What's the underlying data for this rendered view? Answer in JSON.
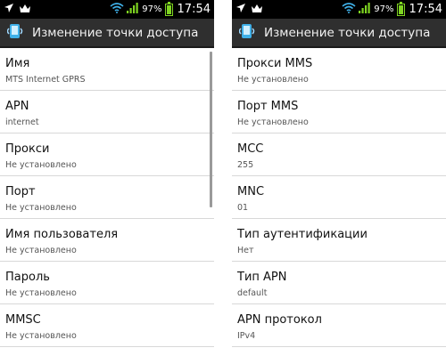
{
  "status_bar": {
    "battery_percent": "97%",
    "time": "17:54",
    "icons": [
      "navigation-arrow-icon",
      "crown-icon",
      "wifi-icon",
      "signal-icon",
      "battery-icon"
    ],
    "colors": {
      "wifi": "#3fb0e8",
      "signal": "#7ed321",
      "battery": "#7ed321"
    }
  },
  "action_bar": {
    "title": "Изменение точки доступа",
    "icon": "apn-settings-icon"
  },
  "left_screen": {
    "items": [
      {
        "title": "Имя",
        "value": "MTS Internet GPRS"
      },
      {
        "title": "APN",
        "value": "internet"
      },
      {
        "title": "Прокси",
        "value": "Не установлено"
      },
      {
        "title": "Порт",
        "value": "Не установлено"
      },
      {
        "title": "Имя пользователя",
        "value": "Не установлено"
      },
      {
        "title": "Пароль",
        "value": "Не установлено"
      },
      {
        "title": "MMSC",
        "value": "Не установлено"
      }
    ]
  },
  "right_screen": {
    "items": [
      {
        "title": "Прокси MMS",
        "value": "Не установлено"
      },
      {
        "title": "Порт MMS",
        "value": "Не установлено"
      },
      {
        "title": "MCC",
        "value": "255"
      },
      {
        "title": "MNC",
        "value": "01"
      },
      {
        "title": "Тип аутентификации",
        "value": "Нет"
      },
      {
        "title": "Тип APN",
        "value": "default"
      },
      {
        "title": "APN протокол",
        "value": "IPv4"
      }
    ]
  }
}
